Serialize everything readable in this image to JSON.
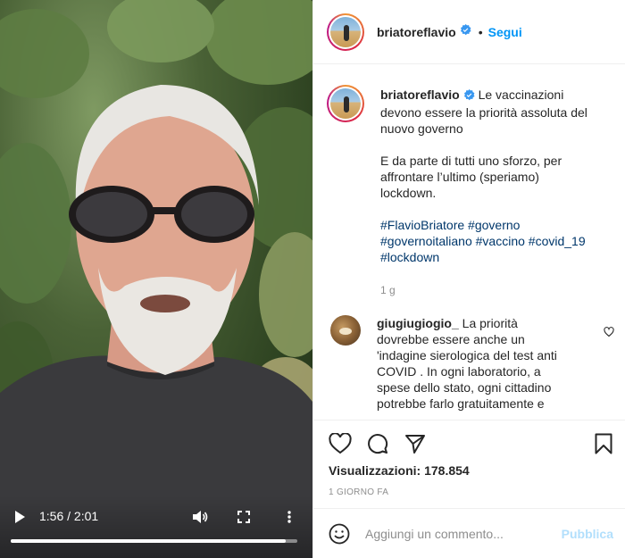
{
  "post": {
    "username": "briatoreflavio",
    "follow_label": "Segui",
    "separator": "•"
  },
  "video": {
    "time_display": "1:56 / 2:01",
    "progress": 0.959
  },
  "caption": {
    "lines": [
      "Le vaccinazioni",
      "devono essere la priorità assoluta del",
      "nuovo governo",
      "",
      "E da parte di tutti uno sforzo, per",
      "affrontare l’ultimo (speriamo)",
      "lockdown.",
      ""
    ],
    "hashtag_lines": [
      [
        "#FlavioBriatore",
        "#governo"
      ],
      [
        "#governoitaliano",
        "#vaccino",
        "#covid_19"
      ],
      [
        "#lockdown"
      ]
    ],
    "time_ago": "1 g"
  },
  "comment": {
    "username": "giugiugiogio_",
    "first_line": "La priorità",
    "lines": [
      "dovrebbe essere anche un",
      "'indagine sierologica del test anti",
      "COVID . In ogni laboratorio, a",
      "spese dello stato, ogni cittadino",
      "potrebbe farlo gratuitamente e"
    ]
  },
  "stats": {
    "views_label": "Visualizzazioni:",
    "views_count": "178.854",
    "date": "1 GIORNO FA"
  },
  "add_comment": {
    "placeholder": "Aggiungi un commento...",
    "publish_label": "Pubblica"
  },
  "colors": {
    "link_blue": "#0095f6",
    "hashtag": "#00376b",
    "publish_disabled": "#b2dffc",
    "muted": "#8e8e8e"
  }
}
